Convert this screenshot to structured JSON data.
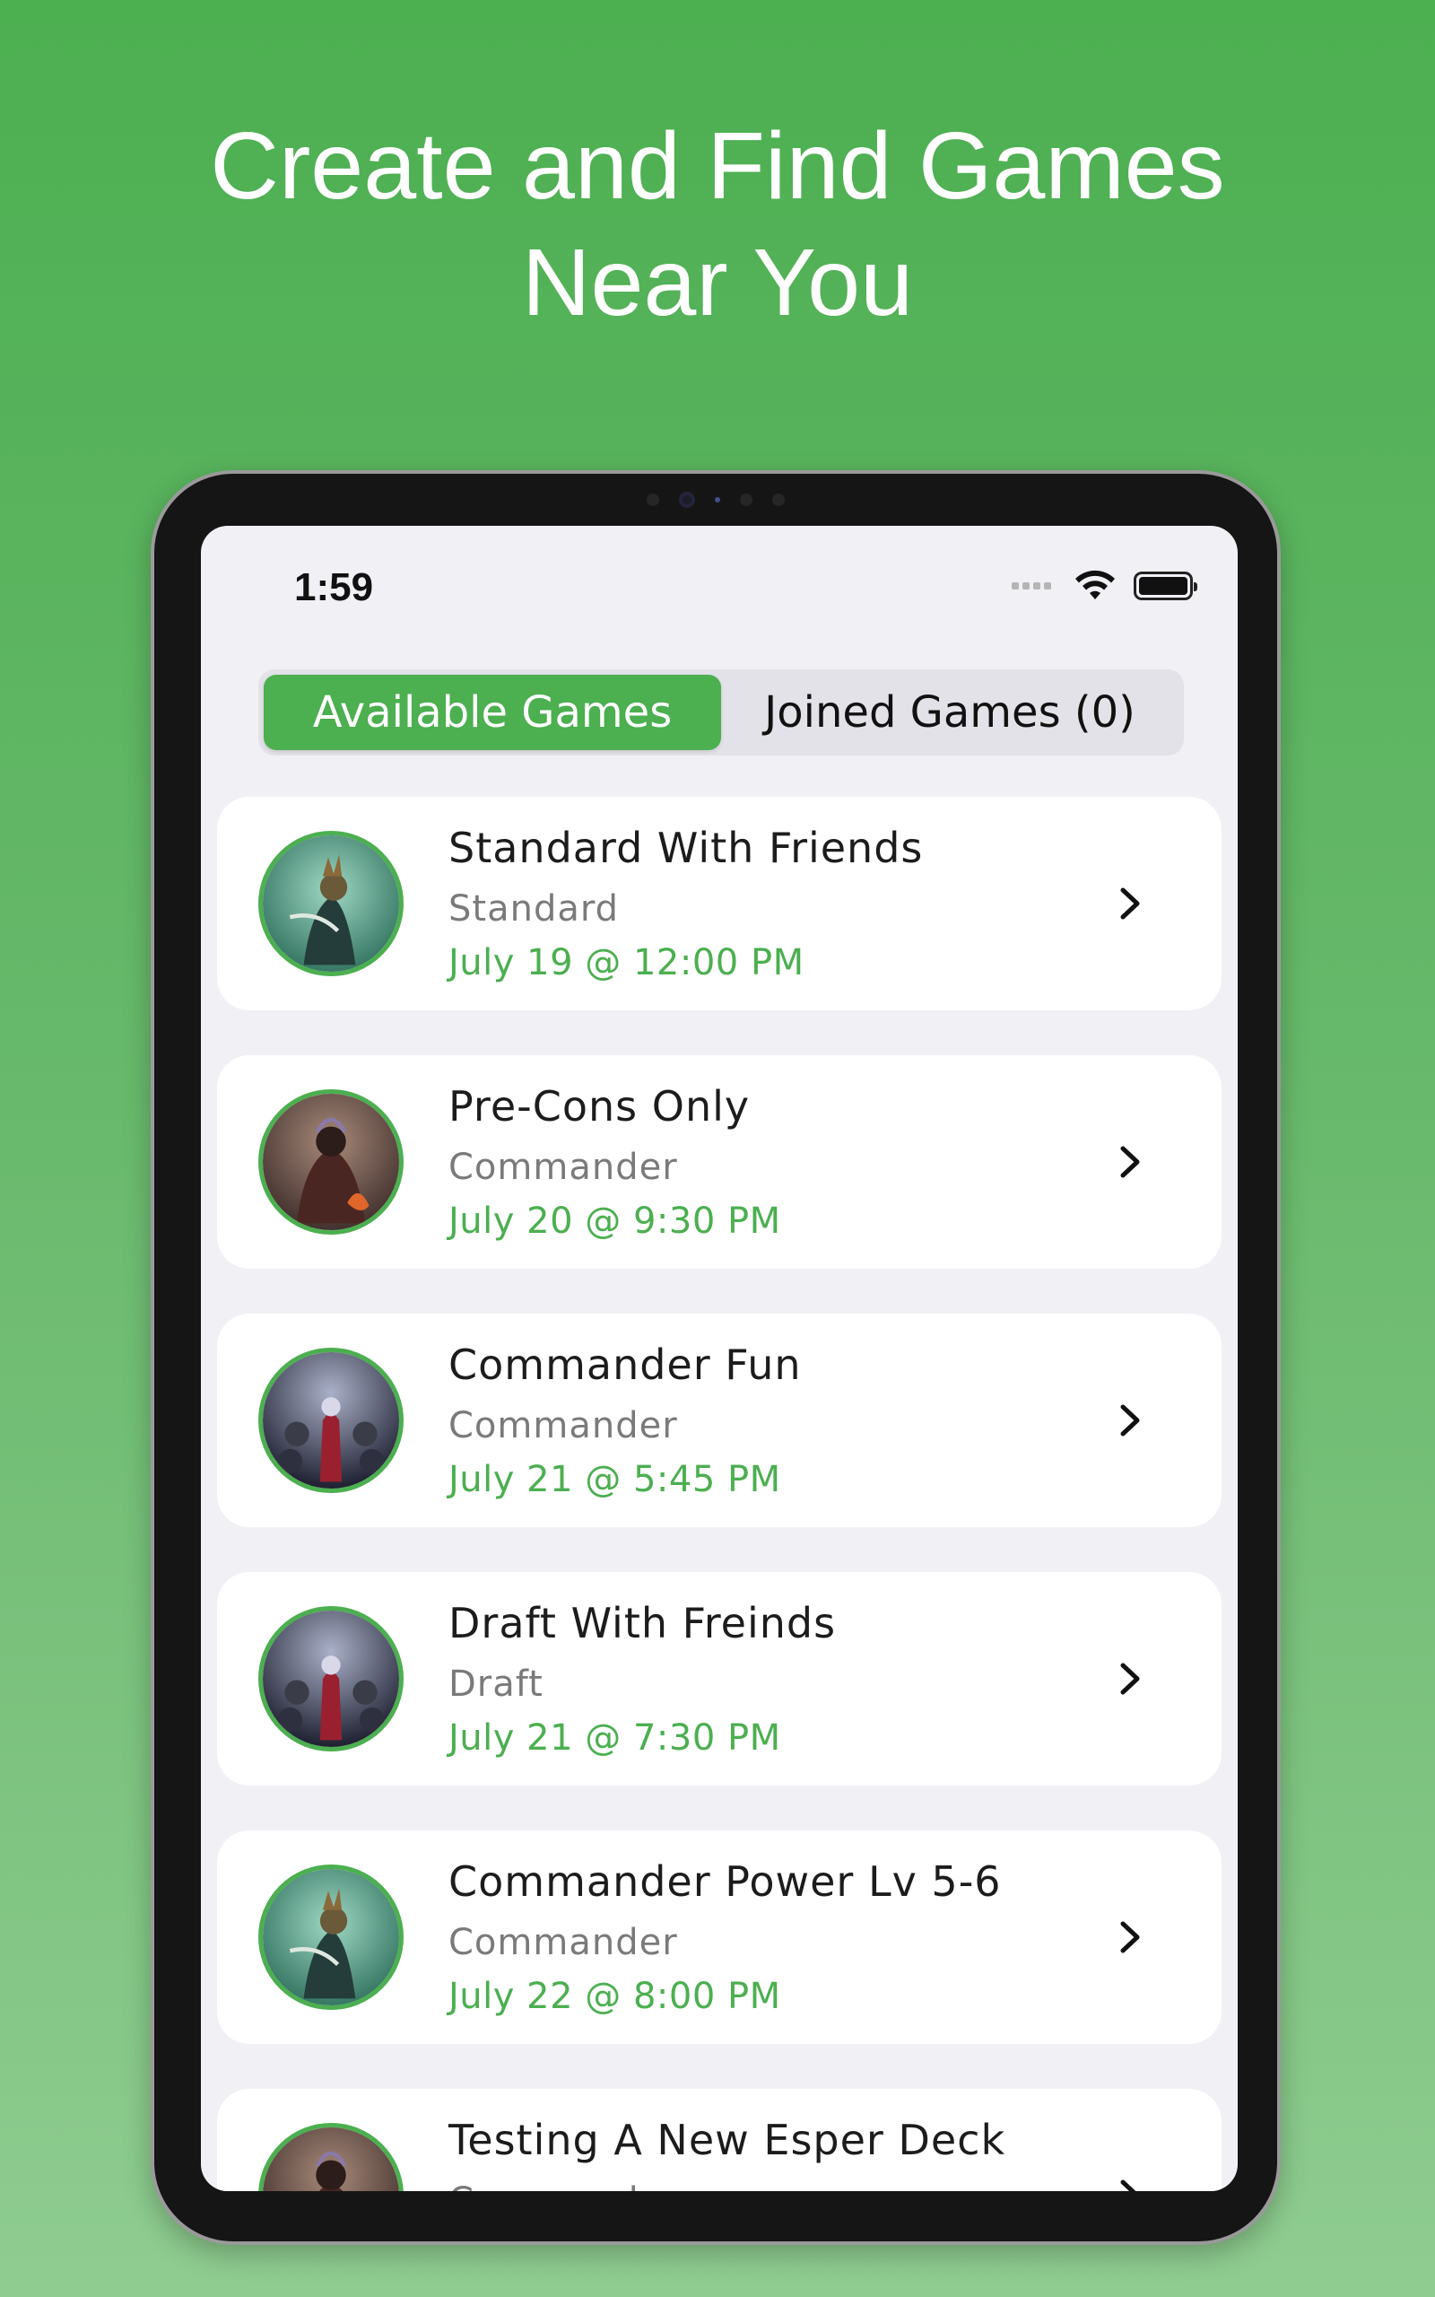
{
  "promo": {
    "line1": "Create and Find Games",
    "line2": "Near You"
  },
  "status_bar": {
    "time": "1:59"
  },
  "tabs": [
    {
      "label": "Available Games",
      "active": true
    },
    {
      "label": "Joined Games (0)",
      "active": false
    }
  ],
  "games": [
    {
      "title": "Standard With Friends",
      "format": "Standard",
      "date": "July 19 @ 12:00 PM",
      "avatar": "green-art"
    },
    {
      "title": "Pre-Cons Only",
      "format": "Commander",
      "date": "July 20 @ 9:30 PM",
      "avatar": "fire-art"
    },
    {
      "title": "Commander Fun",
      "format": "Commander",
      "date": "July 21 @ 5:45 PM",
      "avatar": "dark-art"
    },
    {
      "title": "Draft With Freinds",
      "format": "Draft",
      "date": "July 21 @ 7:30 PM",
      "avatar": "dark-art"
    },
    {
      "title": "Commander Power Lv 5-6",
      "format": "Commander",
      "date": "July 22 @ 8:00 PM",
      "avatar": "green-art"
    },
    {
      "title": "Testing A New Esper Deck",
      "format": "Commander",
      "date": "",
      "avatar": "fire-art"
    }
  ],
  "colors": {
    "accent": "#4caf50",
    "screen_bg": "#f1f0f5",
    "card_bg": "#ffffff"
  }
}
